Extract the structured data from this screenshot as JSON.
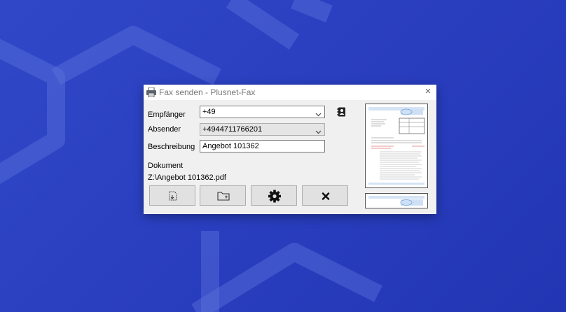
{
  "window": {
    "title": "Fax senden - Plusnet-Fax",
    "close_glyph": "×"
  },
  "form": {
    "recipient_label": "Empfänger",
    "recipient_value": "+49",
    "sender_label": "Absender",
    "sender_value": "+4944711766201",
    "description_label": "Beschreibung",
    "description_value": "Angebot 101362",
    "document_label": "Dokument",
    "document_path": "Z:\\Angebot 101362.pdf"
  },
  "icons": {
    "app": "fax-printer-icon",
    "addressbook": "address-book-icon",
    "scan": "scan-document-icon",
    "open": "open-folder-icon",
    "settings": "gear-icon",
    "cancel": "close-x-icon",
    "dropdown": "chevron-down-icon"
  },
  "colors": {
    "background": "#2a3fc0",
    "window": "#f0f0f0",
    "button": "#e1e1e1",
    "field_readonly": "#e5e5e5"
  }
}
